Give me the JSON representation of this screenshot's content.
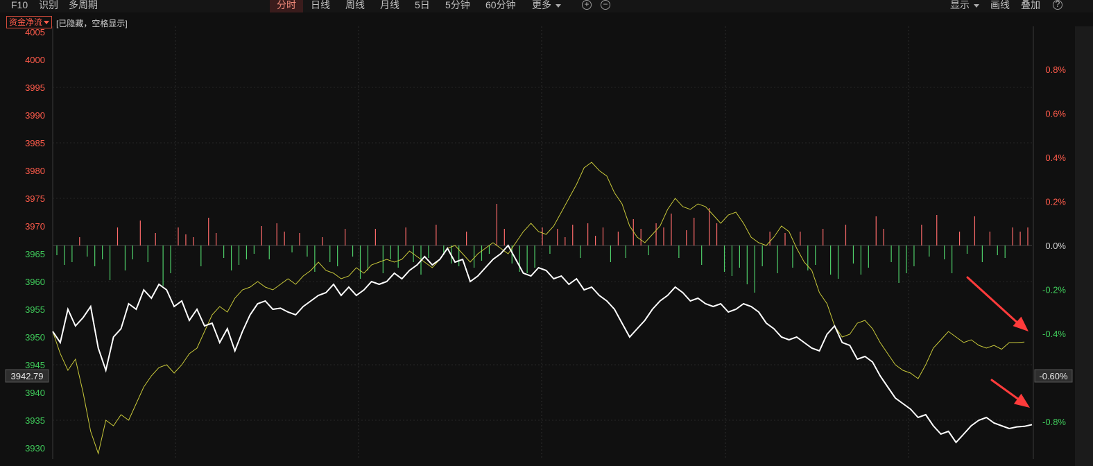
{
  "toolbar": {
    "left_items": [
      "F10",
      "识别",
      "多周期"
    ],
    "tabs": [
      {
        "label": "分时",
        "active": true
      },
      {
        "label": "日线",
        "active": false
      },
      {
        "label": "周线",
        "active": false
      },
      {
        "label": "月线",
        "active": false
      },
      {
        "label": "5日",
        "active": false
      },
      {
        "label": "5分钟",
        "active": false
      },
      {
        "label": "60分钟",
        "active": false
      },
      {
        "label": "更多",
        "active": false
      }
    ],
    "zoom_in_icon": "plus-circle-icon",
    "zoom_out_icon": "minus-circle-icon",
    "right_items": {
      "display": "显示",
      "draw": "画线",
      "overlay": "叠加"
    },
    "help_icon": "question-circle-icon"
  },
  "indicator": {
    "selector_label": "资金净流",
    "note": "[已隐藏，空格显示]"
  },
  "colors": {
    "background": "#101010",
    "price_line": "#ffffff",
    "avg_line": "#c8c83a",
    "inflow_bar": "#ff6b6b",
    "outflow_bar": "#4fd06a",
    "up_text": "#ff5b4b",
    "down_text": "#3fca5a",
    "arrow": "#ff3b3b"
  },
  "chart_data": {
    "type": "line",
    "y_left": {
      "min": 3928,
      "max": 4006,
      "ticks": [
        4005,
        4000,
        3995,
        3990,
        3985,
        3980,
        3975,
        3970,
        3965,
        3960,
        3955,
        3950,
        3945,
        3940,
        3935,
        3930
      ],
      "baseline": 3966.5
    },
    "y_right_ticks": [
      "0.8%",
      "0.6%",
      "0.4%",
      "0.2%",
      "0.0%",
      "-0.2%",
      "-0.4%",
      "-0.8%"
    ],
    "current_price_label": "3942.79",
    "current_pct_label": "-0.60%",
    "grid": true,
    "annotations": [
      "red-arrow-yellow-line-end",
      "red-arrow-white-line-end"
    ],
    "series": [
      {
        "key": "price",
        "values": [
          3951.0,
          3949.0,
          3955.0,
          3952.0,
          3953.5,
          3955.5,
          3948.0,
          3944.0,
          3950.0,
          3951.5,
          3956.0,
          3955.0,
          3958.5,
          3957.0,
          3959.5,
          3958.5,
          3955.5,
          3956.5,
          3953.0,
          3955.0,
          3952.0,
          3952.5,
          3949.0,
          3951.5,
          3947.5,
          3951.0,
          3954.0,
          3956.0,
          3956.5,
          3955.0,
          3955.2,
          3954.5,
          3954.0,
          3955.5,
          3956.5,
          3957.5,
          3958.0,
          3959.5,
          3957.5,
          3959.0,
          3957.5,
          3958.5,
          3960.0,
          3959.5,
          3960.0,
          3961.5,
          3960.5,
          3962.0,
          3963.0,
          3964.5,
          3963.0,
          3964.0,
          3966.0,
          3963.5,
          3964.0,
          3960.0,
          3961.0,
          3962.5,
          3964.0,
          3965.0,
          3966.5,
          3964.0,
          3961.5,
          3961.0,
          3962.5,
          3962.0,
          3960.5,
          3961.0,
          3959.5,
          3960.5,
          3958.5,
          3959.0,
          3957.5,
          3956.5,
          3955.0,
          3952.5,
          3950.0,
          3951.5,
          3953.0,
          3955.0,
          3956.5,
          3957.5,
          3959.0,
          3958.0,
          3956.5,
          3957.0,
          3956.0,
          3955.5,
          3956.0,
          3954.5,
          3955.0,
          3956.0,
          3955.5,
          3954.5,
          3952.5,
          3951.5,
          3950.0,
          3949.5,
          3950.0,
          3949.0,
          3948.0,
          3947.5,
          3950.5,
          3952.0,
          3949.0,
          3948.5,
          3946.0,
          3946.5,
          3945.5,
          3943.0,
          3941.0,
          3939.0,
          3938.0,
          3937.0,
          3935.5,
          3936.0,
          3934.0,
          3932.5,
          3933.0,
          3931.0,
          3932.5,
          3934.0,
          3935.0,
          3935.5,
          3934.5,
          3934.0,
          3933.5,
          3933.8,
          3933.9,
          3934.2
        ]
      },
      {
        "key": "average",
        "values": [
          3951.0,
          3947.0,
          3944.0,
          3946.0,
          3940.0,
          3933.0,
          3929.0,
          3935.0,
          3934.0,
          3936.0,
          3935.0,
          3938.0,
          3941.0,
          3943.0,
          3944.5,
          3945.0,
          3943.5,
          3945.0,
          3947.0,
          3948.0,
          3951.0,
          3954.0,
          3955.5,
          3954.5,
          3957.0,
          3958.5,
          3959.0,
          3960.0,
          3959.0,
          3958.5,
          3959.5,
          3960.5,
          3959.5,
          3961.0,
          3962.0,
          3963.5,
          3962.0,
          3961.5,
          3960.5,
          3961.0,
          3962.5,
          3961.5,
          3963.0,
          3963.5,
          3964.0,
          3963.5,
          3964.0,
          3965.5,
          3964.5,
          3963.5,
          3962.5,
          3964.0,
          3966.0,
          3966.5,
          3965.0,
          3963.5,
          3965.0,
          3966.0,
          3967.0,
          3966.0,
          3965.0,
          3967.0,
          3969.0,
          3970.5,
          3969.0,
          3968.5,
          3970.0,
          3972.5,
          3975.0,
          3977.5,
          3980.5,
          3981.5,
          3980.0,
          3979.0,
          3976.0,
          3974.0,
          3970.0,
          3968.0,
          3967.0,
          3968.5,
          3970.0,
          3973.0,
          3975.0,
          3973.5,
          3973.0,
          3974.0,
          3973.5,
          3972.0,
          3970.5,
          3972.0,
          3972.5,
          3970.5,
          3968.0,
          3967.0,
          3966.5,
          3968.0,
          3970.0,
          3969.0,
          3966.0,
          3963.5,
          3962.0,
          3958.0,
          3956.0,
          3952.0,
          3950.0,
          3950.5,
          3952.5,
          3953.0,
          3951.5,
          3949.0,
          3947.0,
          3945.0,
          3944.0,
          3943.5,
          3942.5,
          3945.0,
          3948.0,
          3949.5,
          3951.0,
          3950.0,
          3949.0,
          3949.5,
          3948.5,
          3948.0,
          3948.5,
          3947.8,
          3949.0,
          3949.0,
          3949.1
        ]
      }
    ],
    "flow_bars": [
      {
        "t": 0.0,
        "v": -0.7
      },
      {
        "t": 1.0,
        "v": -1.4
      },
      {
        "t": 2.0,
        "v": -1.2
      },
      {
        "t": 3.0,
        "v": 0.6
      },
      {
        "t": 4.0,
        "v": -0.8
      },
      {
        "t": 5.0,
        "v": -1.5
      },
      {
        "t": 6.0,
        "v": -1.0
      },
      {
        "t": 7.0,
        "v": -2.5
      },
      {
        "t": 8.0,
        "v": 1.3
      },
      {
        "t": 9.0,
        "v": -1.8
      },
      {
        "t": 10.0,
        "v": -1.0
      },
      {
        "t": 11.0,
        "v": 1.8
      },
      {
        "t": 12.0,
        "v": -1.2
      },
      {
        "t": 13.0,
        "v": 0.9
      },
      {
        "t": 14.0,
        "v": -2.9
      },
      {
        "t": 15.0,
        "v": -2.0
      },
      {
        "t": 16.0,
        "v": 1.3
      },
      {
        "t": 17.0,
        "v": 0.8
      },
      {
        "t": 18.0,
        "v": 0.6
      },
      {
        "t": 19.0,
        "v": -1.5
      },
      {
        "t": 20.0,
        "v": 2.0
      },
      {
        "t": 21.0,
        "v": 0.9
      },
      {
        "t": 22.0,
        "v": -0.9
      },
      {
        "t": 23.0,
        "v": -1.8
      },
      {
        "t": 24.0,
        "v": -1.4
      },
      {
        "t": 25.0,
        "v": -1.0
      },
      {
        "t": 26.0,
        "v": -0.6
      },
      {
        "t": 27.0,
        "v": 1.4
      },
      {
        "t": 28.0,
        "v": -1.0
      },
      {
        "t": 29.0,
        "v": 1.6
      },
      {
        "t": 30.0,
        "v": 1.0
      },
      {
        "t": 31.0,
        "v": -0.5
      },
      {
        "t": 32.0,
        "v": 0.9
      },
      {
        "t": 33.0,
        "v": -0.8
      },
      {
        "t": 34.0,
        "v": -1.9
      },
      {
        "t": 35.0,
        "v": 0.6
      },
      {
        "t": 36.0,
        "v": -1.2
      },
      {
        "t": 37.0,
        "v": -1.5
      },
      {
        "t": 38.0,
        "v": 1.2
      },
      {
        "t": 39.0,
        "v": -0.8
      },
      {
        "t": 40.0,
        "v": -2.4
      },
      {
        "t": 41.0,
        "v": -1.8
      },
      {
        "t": 42.0,
        "v": 1.2
      },
      {
        "t": 43.0,
        "v": -2.0
      },
      {
        "t": 44.0,
        "v": -1.0
      },
      {
        "t": 45.0,
        "v": -1.6
      },
      {
        "t": 46.0,
        "v": 1.3
      },
      {
        "t": 47.0,
        "v": -1.2
      },
      {
        "t": 48.0,
        "v": -2.1
      },
      {
        "t": 49.0,
        "v": -0.9
      },
      {
        "t": 50.0,
        "v": 1.5
      },
      {
        "t": 51.0,
        "v": -0.7
      },
      {
        "t": 52.0,
        "v": -1.3
      },
      {
        "t": 53.0,
        "v": -1.5
      },
      {
        "t": 54.0,
        "v": 1.0
      },
      {
        "t": 55.0,
        "v": -1.6
      },
      {
        "t": 56.0,
        "v": -1.1
      },
      {
        "t": 57.0,
        "v": -0.6
      },
      {
        "t": 58.0,
        "v": 3.0
      },
      {
        "t": 59.0,
        "v": 1.2
      },
      {
        "t": 60.0,
        "v": -1.3
      },
      {
        "t": 61.0,
        "v": -1.9
      },
      {
        "t": 62.0,
        "v": -2.0
      },
      {
        "t": 63.0,
        "v": -1.6
      },
      {
        "t": 64.0,
        "v": 1.3
      },
      {
        "t": 65.0,
        "v": -0.6
      },
      {
        "t": 66.0,
        "v": 1.2
      },
      {
        "t": 67.0,
        "v": 0.6
      },
      {
        "t": 68.0,
        "v": 1.5
      },
      {
        "t": 69.0,
        "v": -0.9
      },
      {
        "t": 70.0,
        "v": 1.6
      },
      {
        "t": 71.0,
        "v": 0.7
      },
      {
        "t": 72.0,
        "v": 1.3
      },
      {
        "t": 73.0,
        "v": -1.2
      },
      {
        "t": 74.0,
        "v": 1.0
      },
      {
        "t": 75.0,
        "v": -0.9
      },
      {
        "t": 76.0,
        "v": 1.9
      },
      {
        "t": 77.0,
        "v": 1.2
      },
      {
        "t": 78.0,
        "v": -0.7
      },
      {
        "t": 79.0,
        "v": 1.6
      },
      {
        "t": 80.0,
        "v": 1.3
      },
      {
        "t": 81.0,
        "v": 2.3
      },
      {
        "t": 82.0,
        "v": -0.9
      },
      {
        "t": 83.0,
        "v": 1.1
      },
      {
        "t": 84.0,
        "v": 2.0
      },
      {
        "t": 85.0,
        "v": -1.4
      },
      {
        "t": 86.0,
        "v": 2.7
      },
      {
        "t": 87.0,
        "v": 1.6
      },
      {
        "t": 88.0,
        "v": -1.9
      },
      {
        "t": 89.0,
        "v": -2.2
      },
      {
        "t": 90.0,
        "v": -1.6
      },
      {
        "t": 91.0,
        "v": -2.8
      },
      {
        "t": 92.0,
        "v": -3.4
      },
      {
        "t": 93.0,
        "v": -1.5
      },
      {
        "t": 94.0,
        "v": 1.0
      },
      {
        "t": 95.0,
        "v": -2.0
      },
      {
        "t": 96.0,
        "v": 0.9
      },
      {
        "t": 97.0,
        "v": -1.6
      },
      {
        "t": 98.0,
        "v": 1.0
      },
      {
        "t": 99.0,
        "v": -1.8
      },
      {
        "t": 100.0,
        "v": -1.4
      },
      {
        "t": 101.0,
        "v": 1.2
      },
      {
        "t": 102.0,
        "v": -2.1
      },
      {
        "t": 103.0,
        "v": -2.4
      },
      {
        "t": 104.0,
        "v": 1.5
      },
      {
        "t": 105.0,
        "v": -1.3
      },
      {
        "t": 106.0,
        "v": -2.1
      },
      {
        "t": 107.0,
        "v": -1.6
      },
      {
        "t": 108.0,
        "v": 2.1
      },
      {
        "t": 109.0,
        "v": 1.2
      },
      {
        "t": 110.0,
        "v": -1.2
      },
      {
        "t": 111.0,
        "v": -2.7
      },
      {
        "t": 112.0,
        "v": -2.0
      },
      {
        "t": 113.0,
        "v": -1.5
      },
      {
        "t": 114.0,
        "v": 1.5
      },
      {
        "t": 115.0,
        "v": -0.8
      },
      {
        "t": 116.0,
        "v": 2.2
      },
      {
        "t": 117.0,
        "v": -1.0
      },
      {
        "t": 118.0,
        "v": -2.0
      },
      {
        "t": 119.0,
        "v": 1.0
      },
      {
        "t": 120.0,
        "v": -0.6
      },
      {
        "t": 121.0,
        "v": 2.1
      },
      {
        "t": 122.0,
        "v": -1.2
      },
      {
        "t": 123.0,
        "v": 1.0
      },
      {
        "t": 124.0,
        "v": -0.7
      },
      {
        "t": 125.0,
        "v": -0.9
      },
      {
        "t": 126.0,
        "v": 1.3
      },
      {
        "t": 127.0,
        "v": 1.0
      },
      {
        "t": 128.0,
        "v": 1.3
      }
    ]
  }
}
